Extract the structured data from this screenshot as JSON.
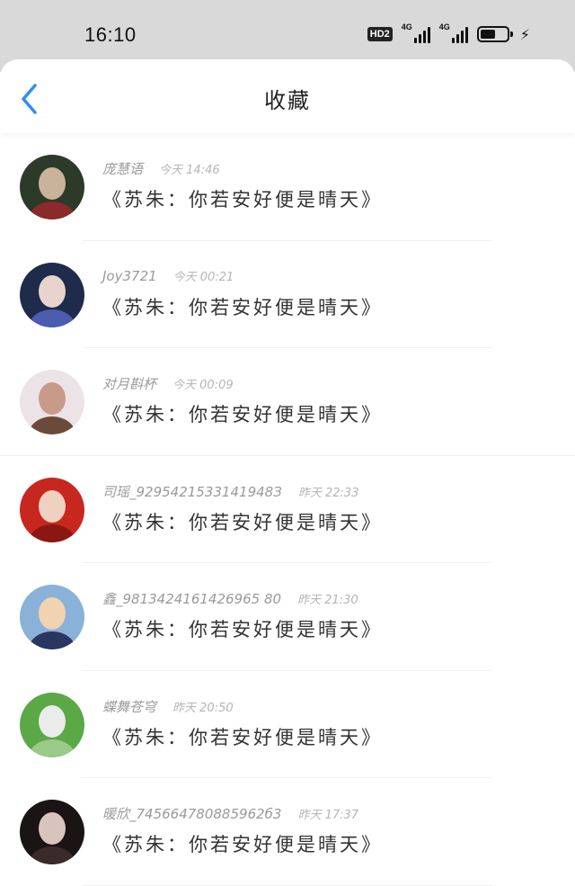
{
  "status_bar": {
    "time": "16:10",
    "hd": "HD2",
    "network1": "4G",
    "network2": "4G",
    "battery_level": 0.6
  },
  "header": {
    "back_icon": "chevron-left-icon",
    "title": "收藏",
    "accent_color": "#2f8ff0"
  },
  "items": [
    {
      "username": "庞慧语",
      "time": "今天 14:46",
      "text": "《苏朱：你若安好便是晴天》",
      "avatar_colors": [
        "#2c3a2a",
        "#c9b39a",
        "#8b2a2a"
      ]
    },
    {
      "username": "Joy3721",
      "time": "今天 00:21",
      "text": "《苏朱：你若安好便是晴天》",
      "avatar_colors": [
        "#1f2b4a",
        "#e8d3cf",
        "#4a5db0"
      ]
    },
    {
      "username": "对月斟杯",
      "time": "今天 00:09",
      "text": "《苏朱：你若安好便是晴天》",
      "avatar_colors": [
        "#ece3e6",
        "#c89a8a",
        "#6b4a3a"
      ]
    },
    {
      "username": "司瑶_9295421533141948З",
      "time": "昨天 22:33",
      "text": "《苏朱：你若安好便是晴天》",
      "avatar_colors": [
        "#c7271e",
        "#f0d0c0",
        "#8a1712"
      ]
    },
    {
      "username": "鑫_9813424161426965 80",
      "time": "昨天 21:30",
      "text": "《苏朱：你若安好便是晴天》",
      "avatar_colors": [
        "#8ab1d8",
        "#f1d3b1",
        "#2a3560"
      ]
    },
    {
      "username": "蝶舞苍穹",
      "time": "昨天 20:50",
      "text": "《苏朱：你若安好便是晴天》",
      "avatar_colors": [
        "#5aa846",
        "#e9ece8",
        "#9bc98a"
      ]
    },
    {
      "username": "暖欣_745664780885962б3",
      "time": "昨天 17:37",
      "text": "《苏朱：你若安好便是晴天》",
      "avatar_colors": [
        "#1a1414",
        "#d8c3bd",
        "#3b2a2a"
      ]
    }
  ]
}
